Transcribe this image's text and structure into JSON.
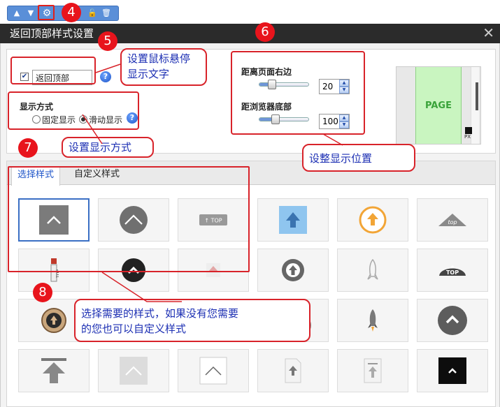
{
  "window": {
    "title": "返回顶部样式设置"
  },
  "settings": {
    "hover_label": "返回顶部",
    "display_mode_label": "显示方式",
    "mode_fixed": "固定显示",
    "mode_scroll": "滑动显示",
    "right_distance_label": "距离页面右边",
    "right_distance_value": "20",
    "right_distance_fraction": 0.2,
    "bottom_distance_label": "距浏览器底部",
    "bottom_distance_value": "100",
    "bottom_distance_fraction": 0.3,
    "preview_page_label": "PAGE",
    "preview_px_label": "PX"
  },
  "tabs": [
    {
      "label": "选择样式"
    },
    {
      "label": "自定义样式"
    }
  ],
  "style_items": {
    "top_text": "TOP",
    "top_text_lower": "top",
    "top_arrow_text": "↑ TOP"
  },
  "annotations": {
    "badge_4": "4",
    "badge_5": "5",
    "badge_6": "6",
    "badge_7": "7",
    "badge_8": "8",
    "callout_hover_text": "设置鼠标悬停\n显示文字",
    "callout_display_mode": "设置显示方式",
    "callout_position": "设整显示位置",
    "callout_styles": "选择需要的样式，如果没有您需要\n的您也可以自定义样式"
  },
  "colors": {
    "accent": "#1f55c9",
    "annotation_red": "#e8141c",
    "toolbar_blue": "#5a8fd8"
  }
}
